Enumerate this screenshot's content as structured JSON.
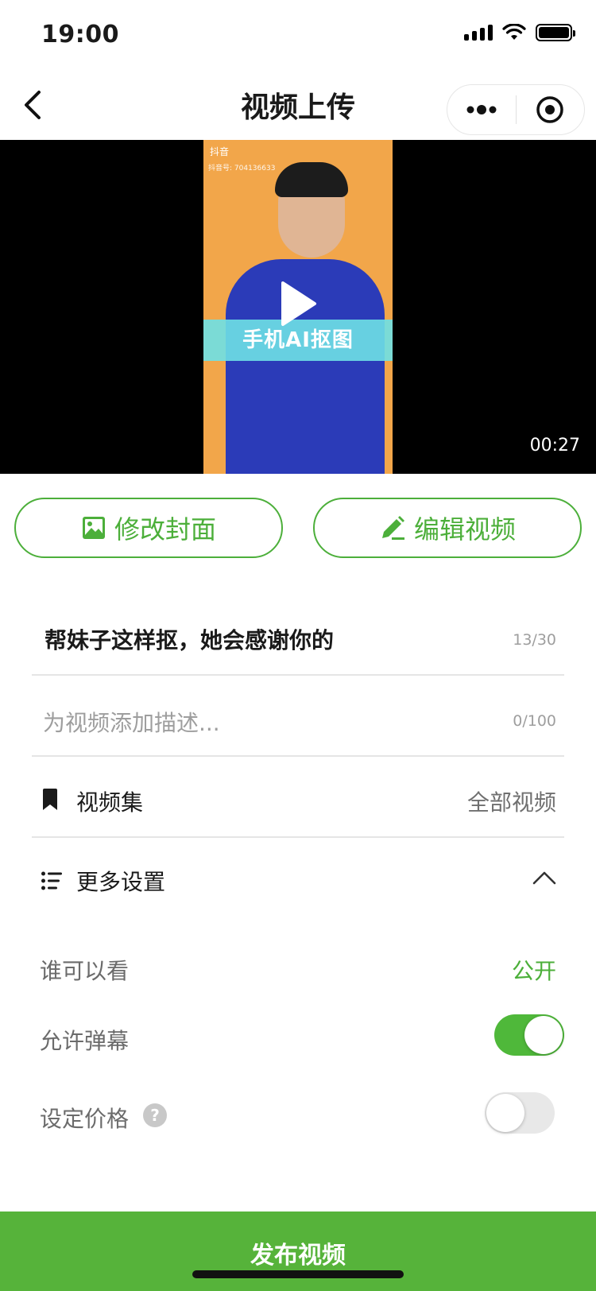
{
  "status_bar": {
    "time": "19:00"
  },
  "nav": {
    "title": "视频上传"
  },
  "video": {
    "caption": "手机AI抠图",
    "brand": "抖音",
    "account_id": "抖音号: 704136633",
    "duration": "00:27"
  },
  "actions": {
    "cover_label": "修改封面",
    "edit_label": "编辑视频"
  },
  "form": {
    "title": "帮妹子这样抠，她会感谢你的",
    "title_counter": "13/30",
    "description_placeholder": "为视频添加描述...",
    "description_counter": "0/100",
    "collection_label": "视频集",
    "collection_value": "全部视频",
    "more_settings_label": "更多设置"
  },
  "settings": {
    "visibility_label": "谁可以看",
    "visibility_value": "公开",
    "danmu_label": "允许弹幕",
    "danmu_enabled": true,
    "price_label": "设定价格",
    "price_enabled": false,
    "help_glyph": "?"
  },
  "publish": {
    "label": "发布视频"
  },
  "colors": {
    "accent": "#4caf3a",
    "publish_bg": "#56b33a",
    "video_bg": "#000000"
  }
}
